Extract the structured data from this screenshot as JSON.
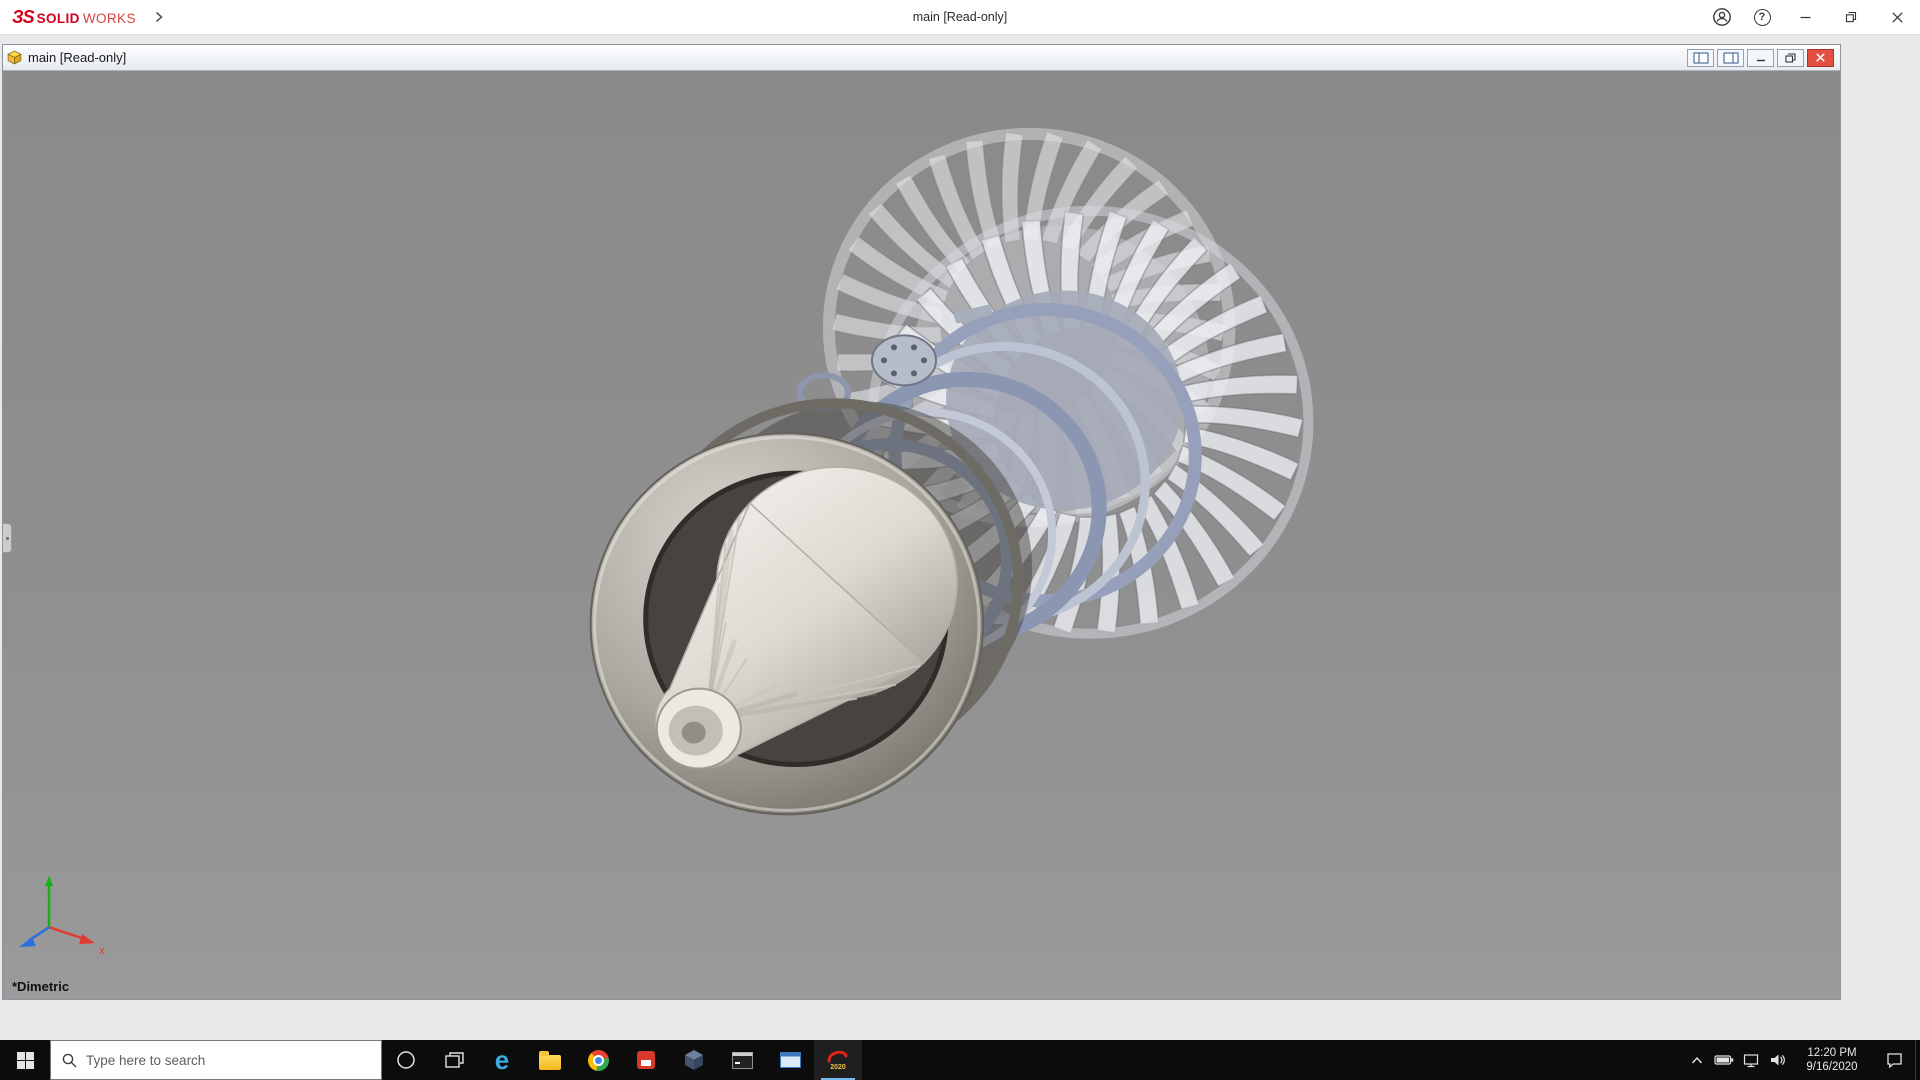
{
  "app": {
    "brand_mark": "ЗS",
    "brand_solid": "SOLID",
    "brand_works": "WORKS",
    "title": "main [Read-only]"
  },
  "doc": {
    "title": "main [Read-only]",
    "view_orientation": "*Dimetric",
    "triad_x_label": "x"
  },
  "icons": {
    "edge_glyph": "e",
    "help_glyph": "?"
  },
  "taskbar": {
    "search_placeholder": "Type here to search",
    "time": "12:20 PM",
    "date": "9/16/2020",
    "solidworks_badge": "2020"
  },
  "colors": {
    "brand_red": "#d6001c",
    "taskbar_bg": "#0c0c0c",
    "viewport_gray": "#8f8f8f",
    "doc_close_red": "#e25041"
  }
}
